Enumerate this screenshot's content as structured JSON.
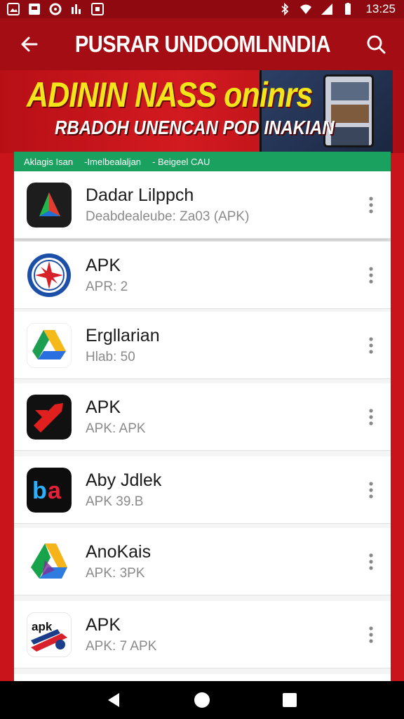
{
  "status_bar": {
    "time": "13:25",
    "left_icons": [
      "gallery-icon",
      "message-icon",
      "sync-icon",
      "chart-icon",
      "download-icon"
    ],
    "right_icons": [
      "bluetooth-icon",
      "wifi-icon",
      "signal-icon",
      "battery-icon"
    ]
  },
  "app_bar": {
    "title": "PUSRAR UNDOOMLNNDIA",
    "back_icon": "arrow-left-icon",
    "search_icon": "search-icon"
  },
  "banner": {
    "headline": "ADININ NASS oninrs",
    "subline": "RBADOH UNENCAN POD INAKIAN"
  },
  "list": {
    "tabs_strip": [
      "Aklagis Isan",
      "-Imelbealaljan",
      "- Beigeel CAU"
    ],
    "items": [
      {
        "name": "Dadar Lilppch",
        "meta": "Deabdealeube: Za03 (APK)",
        "icon": "triangle-play-icon"
      },
      {
        "name": "APK",
        "meta": "APR: 2",
        "icon": "compass-star-icon"
      },
      {
        "name": "Ergllarian",
        "meta": "Hlab: 50",
        "icon": "drive-triangle-icon"
      },
      {
        "name": "APK",
        "meta": "APK: APK",
        "icon": "red-arrow-icon"
      },
      {
        "name": "Aby Jdlek",
        "meta": "APK 39.B",
        "icon": "ba-logo-icon"
      },
      {
        "name": "AnoKais",
        "meta": "APK: 3PK",
        "icon": "green-triangle-icon"
      },
      {
        "name": "APK",
        "meta": "APK: 7 APK",
        "icon": "apkd-logo-icon"
      }
    ],
    "row_more_icon": "more-vert-icon"
  },
  "colors": {
    "status_bar": "#8e0a10",
    "app_bar": "#a50d14",
    "background": "#c8141a",
    "banner_headline": "#f4e51b",
    "tabs_strip": "#1aa160"
  },
  "nav_bar": {
    "icons": [
      "back-triangle-icon",
      "home-circle-icon",
      "recents-square-icon"
    ]
  }
}
